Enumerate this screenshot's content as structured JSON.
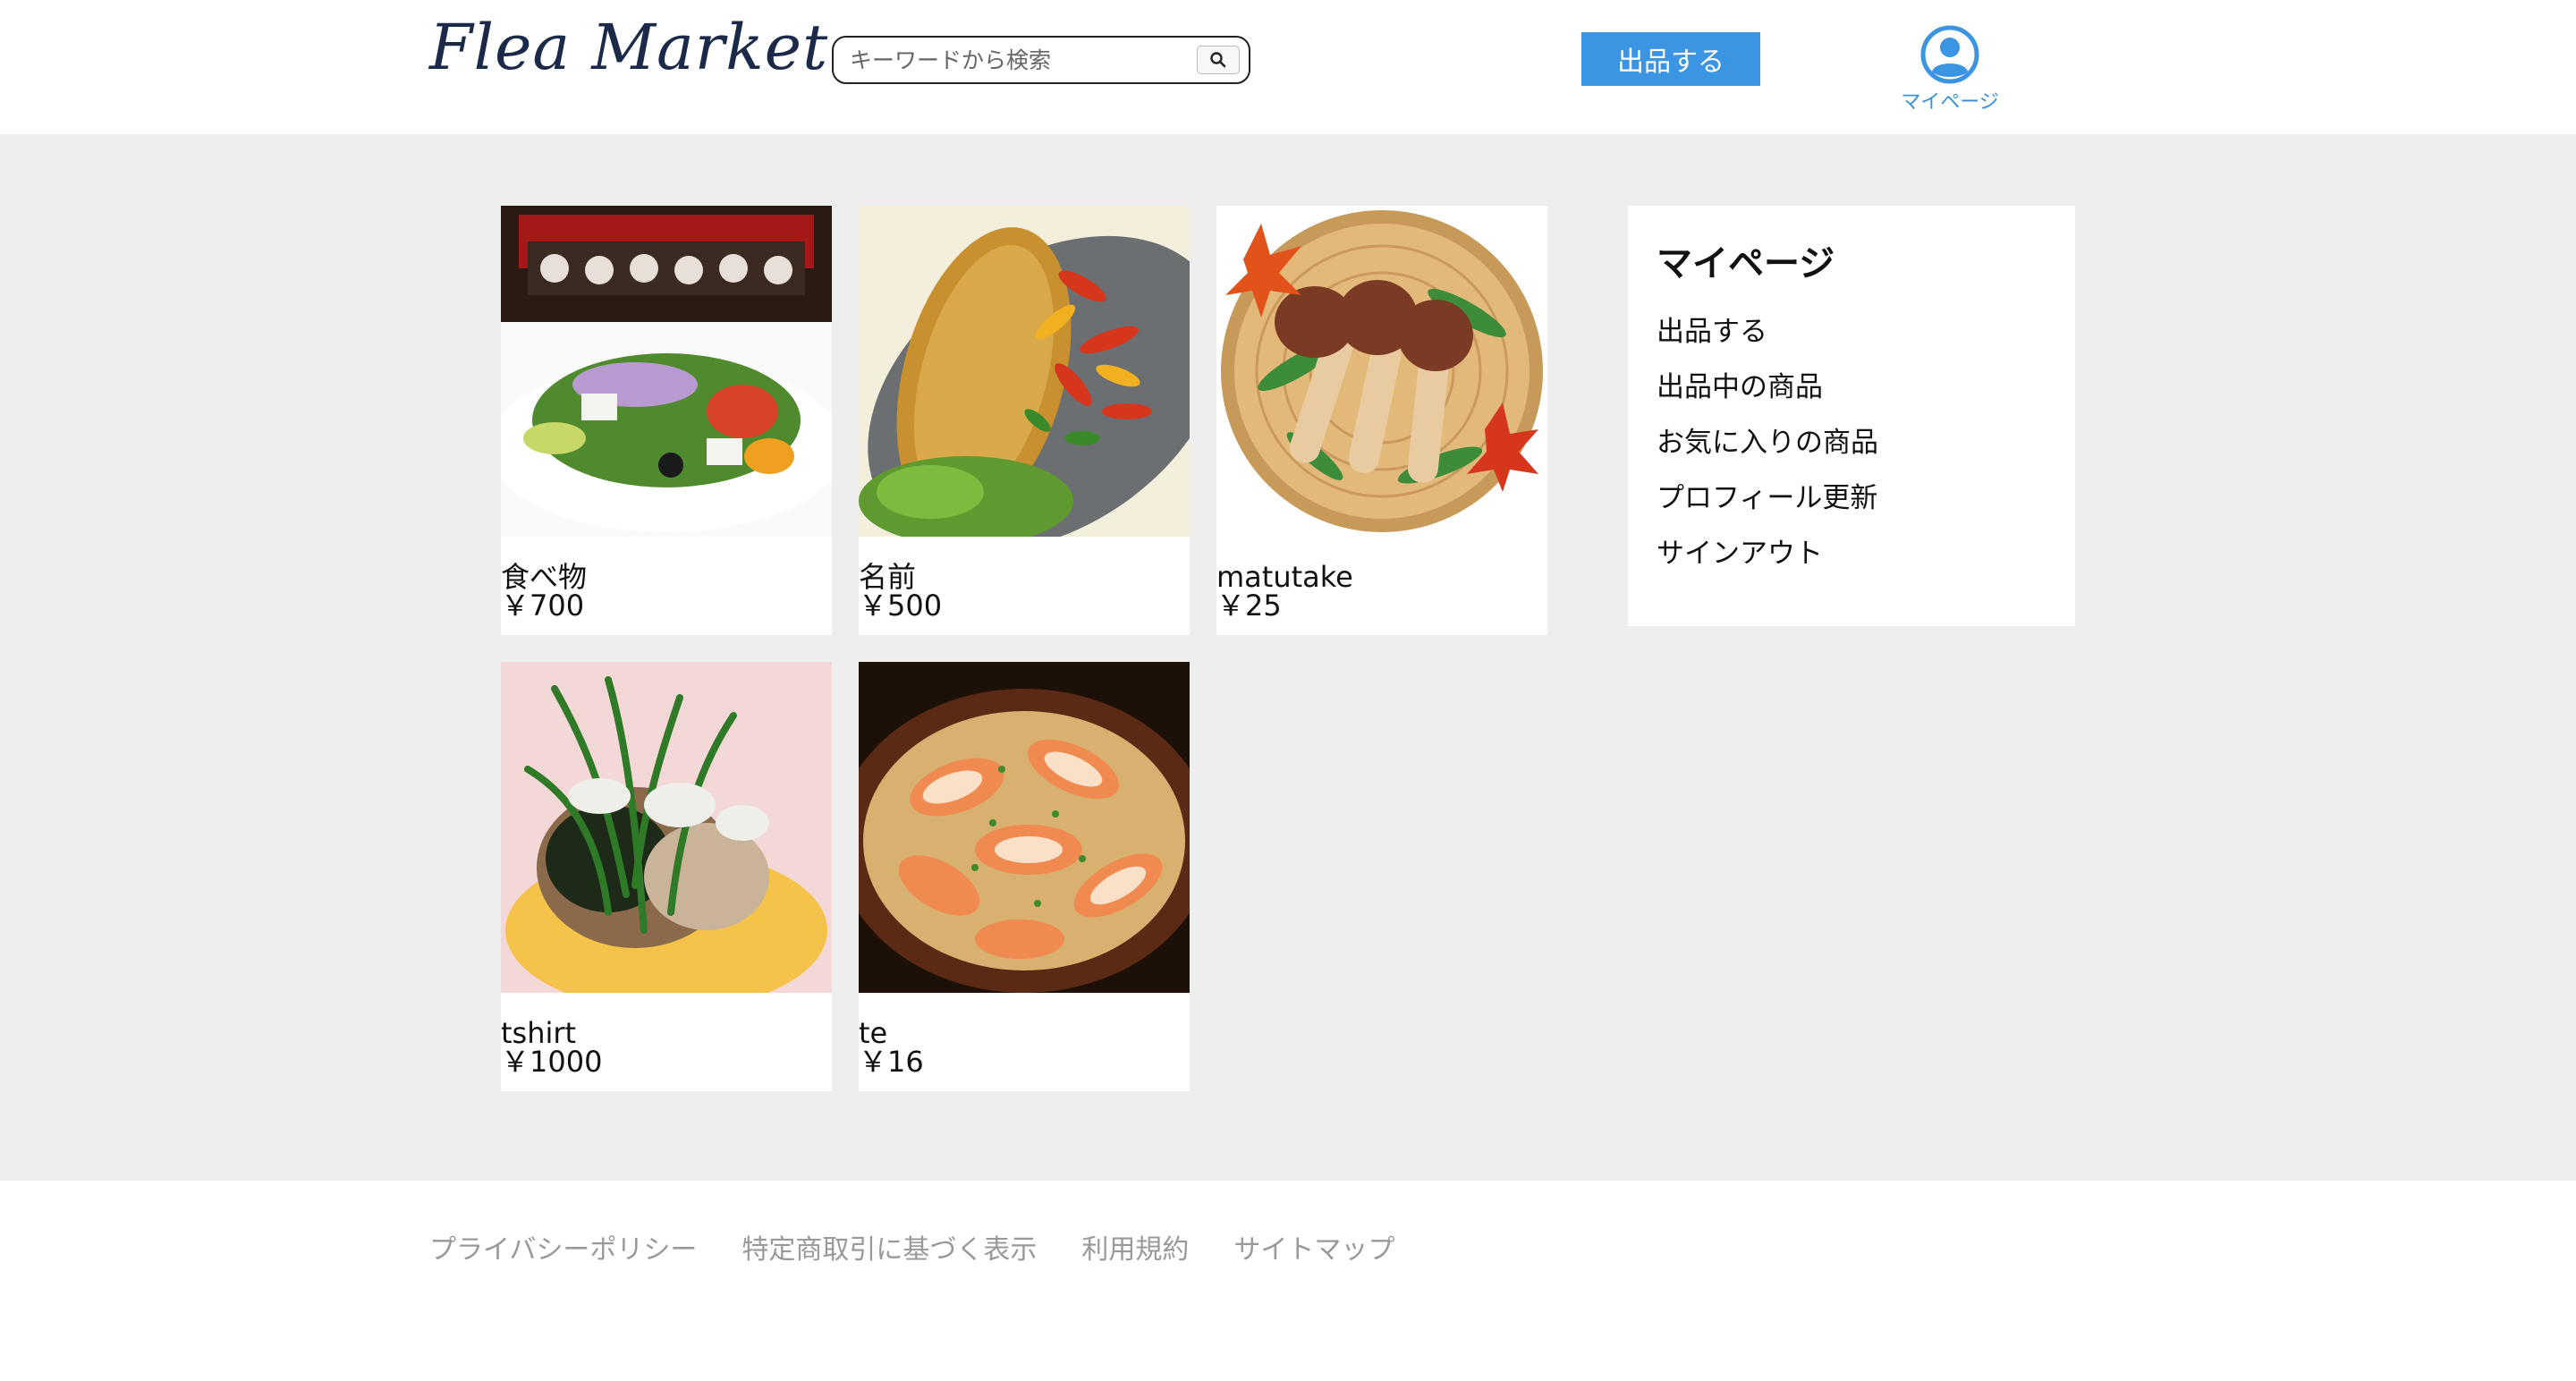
{
  "header": {
    "logo": "Flea Market",
    "search_placeholder": "キーワードから検索",
    "sell_button": "出品する",
    "mypage_label": "マイページ"
  },
  "items": [
    {
      "name": "食べ物",
      "price": "￥700"
    },
    {
      "name": "名前",
      "price": "￥500"
    },
    {
      "name": "matutake",
      "price": "￥25"
    },
    {
      "name": "tshirt",
      "price": "￥1000"
    },
    {
      "name": "te",
      "price": "￥16"
    }
  ],
  "side_menu": {
    "title": "マイページ",
    "items": [
      "出品する",
      "出品中の商品",
      "お気に入りの商品",
      "プロフィール更新",
      "サインアウト"
    ]
  },
  "footer": {
    "links": [
      "プライバシーポリシー",
      "特定商取引に基づく表示",
      "利用規約",
      "サイトマップ"
    ]
  },
  "colors": {
    "accent": "#3b95e3",
    "page_bg": "#eeeeee",
    "footer_text": "#999999"
  }
}
